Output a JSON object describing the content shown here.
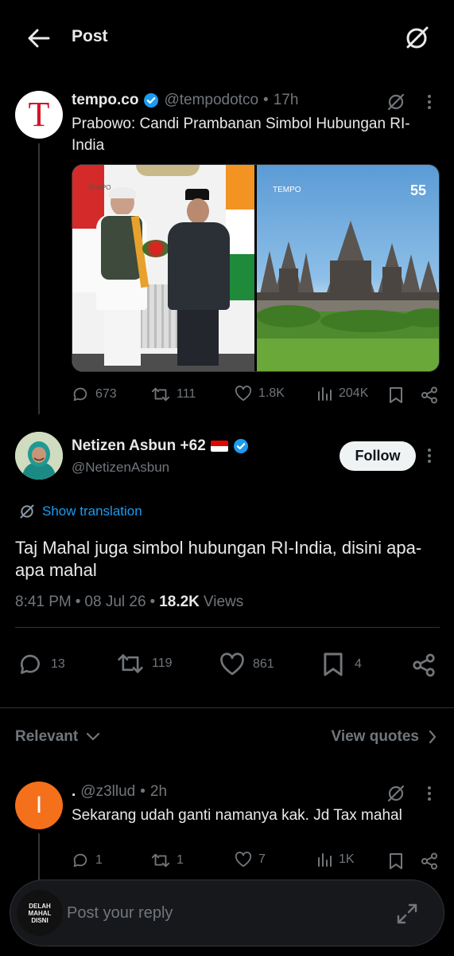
{
  "header": {
    "title": "Post"
  },
  "parent_tweet": {
    "avatar_letter": "T",
    "name": "tempo.co",
    "handle": "@tempodotco",
    "time": "17h",
    "text": "Prabowo: Candi Prambanan Simbol Hubungan RI-India",
    "media_watermark_left": "TEMPO",
    "media_watermark_right": "TEMPO",
    "replies": "673",
    "reposts": "111",
    "likes": "1.8K",
    "views": "204K"
  },
  "main_tweet": {
    "name": "Netizen Asbun +62",
    "flag": "🇮🇩",
    "handle": "@NetizenAsbun",
    "follow_label": "Follow",
    "translation_label": "Show translation",
    "text": "Taj Mahal juga simbol hubungan RI-India, disini apa-apa mahal",
    "time": "8:41 PM",
    "date": "08 Jul 26",
    "views_count": "18.2K",
    "views_label": "Views",
    "replies": "13",
    "reposts": "119",
    "likes": "861",
    "bookmarks": "4"
  },
  "sort_bar": {
    "relevant_label": "Relevant",
    "view_quotes_label": "View quotes"
  },
  "reply_tweet": {
    "avatar_letter": "I",
    "name": ".",
    "handle": "@z3llud",
    "time": "2h",
    "text": "Sekarang udah ganti namanya kak. Jd Tax mahal",
    "replies": "1",
    "reposts": "1",
    "likes": "7",
    "views": "1K"
  },
  "composer": {
    "placeholder": "Post your reply",
    "avatar_text": "DELAH MAHAL DISNI"
  },
  "colors": {
    "accent": "#1d9bf0",
    "background": "#000000",
    "muted": "#71767b",
    "reply_avatar": "#f4701b"
  }
}
